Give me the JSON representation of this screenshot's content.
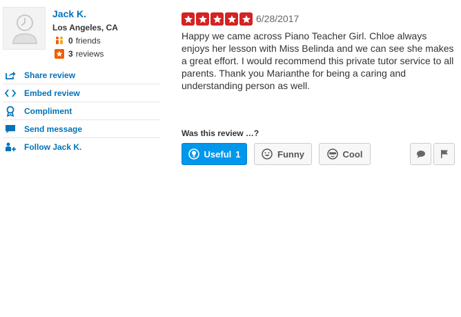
{
  "user": {
    "name": "Jack K.",
    "location": "Los Angeles, CA",
    "friends_count": "0",
    "friends_label": "friends",
    "reviews_count": "3",
    "reviews_label": "reviews",
    "avatar_icon": "user-placeholder-icon"
  },
  "actions": [
    {
      "label": "Share review",
      "icon": "share-icon"
    },
    {
      "label": "Embed review",
      "icon": "embed-icon"
    },
    {
      "label": "Compliment",
      "icon": "award-icon"
    },
    {
      "label": "Send message",
      "icon": "message-icon"
    },
    {
      "label": "Follow Jack K.",
      "icon": "follow-user-icon"
    }
  ],
  "review": {
    "rating": 5,
    "max_rating": 5,
    "date": "6/28/2017",
    "text": "Happy we came across Piano Teacher Girl.  Chloe always enjoys her lesson with Miss Belinda and we can see she makes a great effort.  I would recommend this private tutor service to all parents.  Thank you Marianthe for being a caring and understanding person as well."
  },
  "votes": {
    "prompt": "Was this review …?",
    "useful_label": "Useful",
    "useful_count": "1",
    "funny_label": "Funny",
    "cool_label": "Cool"
  },
  "colors": {
    "link": "#0073bb",
    "star_red": "#d32323",
    "useful_active": "#0097ec"
  }
}
